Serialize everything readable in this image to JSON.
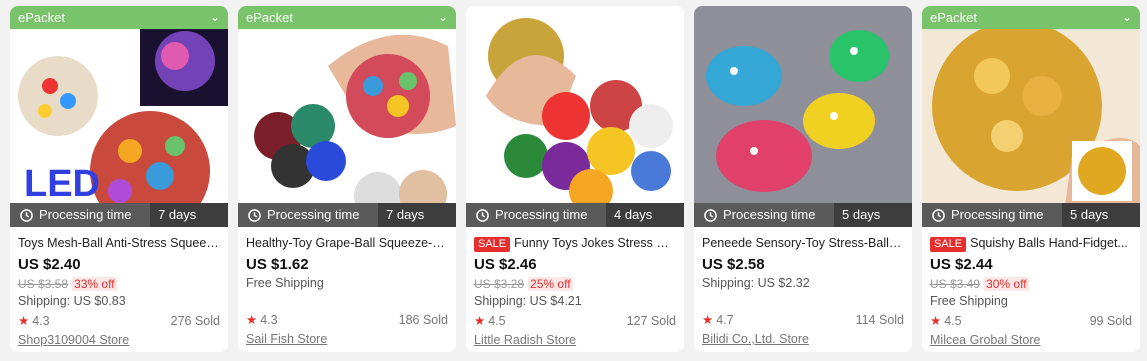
{
  "cards": [
    {
      "epacket": "ePacket",
      "processing_label": "Processing time",
      "processing_days": "7 days",
      "sale": "",
      "title": "Toys Mesh-Ball Anti-Stress Squeez...",
      "price": "US $2.40",
      "original_price": "US $3.58",
      "discount": "33% off",
      "shipping": "Shipping: US $0.83",
      "rating": "4.3",
      "sold": "276 Sold",
      "store": "Shop3109004 Store",
      "image_text": "LED"
    },
    {
      "epacket": "ePacket",
      "processing_label": "Processing time",
      "processing_days": "7 days",
      "sale": "",
      "title": "Healthy-Toy Grape-Ball Squeeze-R...",
      "price": "US $1.62",
      "original_price": "",
      "discount": "",
      "shipping": "Free Shipping",
      "rating": "4.3",
      "sold": "186 Sold",
      "store": "Sail Fish Store"
    },
    {
      "epacket": "",
      "processing_label": "Processing time",
      "processing_days": "4 days",
      "sale": "SALE",
      "title": "Funny Toys Jokes Stress Gi...",
      "price": "US $2.46",
      "original_price": "US $3.28",
      "discount": "25% off",
      "shipping": "Shipping: US $4.21",
      "rating": "4.5",
      "sold": "127 Sold",
      "store": "Little Radish Store"
    },
    {
      "epacket": "",
      "processing_label": "Processing time",
      "processing_days": "5 days",
      "sale": "",
      "title": "Peneede Sensory-Toy Stress-Ball A...",
      "price": "US $2.58",
      "original_price": "",
      "discount": "",
      "shipping": "Shipping: US $2.32",
      "rating": "4.7",
      "sold": "114 Sold",
      "store": "Bilidi Co.,Ltd. Store"
    },
    {
      "epacket": "ePacket",
      "processing_label": "Processing time",
      "processing_days": "5 days",
      "sale": "SALE",
      "title": "Squishy Balls Hand-Fidget...",
      "price": "US $2.44",
      "original_price": "US $3.49",
      "discount": "30% off",
      "shipping": "Free Shipping",
      "rating": "4.5",
      "sold": "99 Sold",
      "store": "Milcea Grobal Store"
    }
  ],
  "colors": {
    "epacket_green": "#79c36b",
    "sale_red": "#e62e2e",
    "processing_bg": "#5a5a5a"
  },
  "icons": {
    "epacket_chevron": "chevron-down-icon",
    "processing": "clock-icon",
    "rating": "star-icon"
  }
}
